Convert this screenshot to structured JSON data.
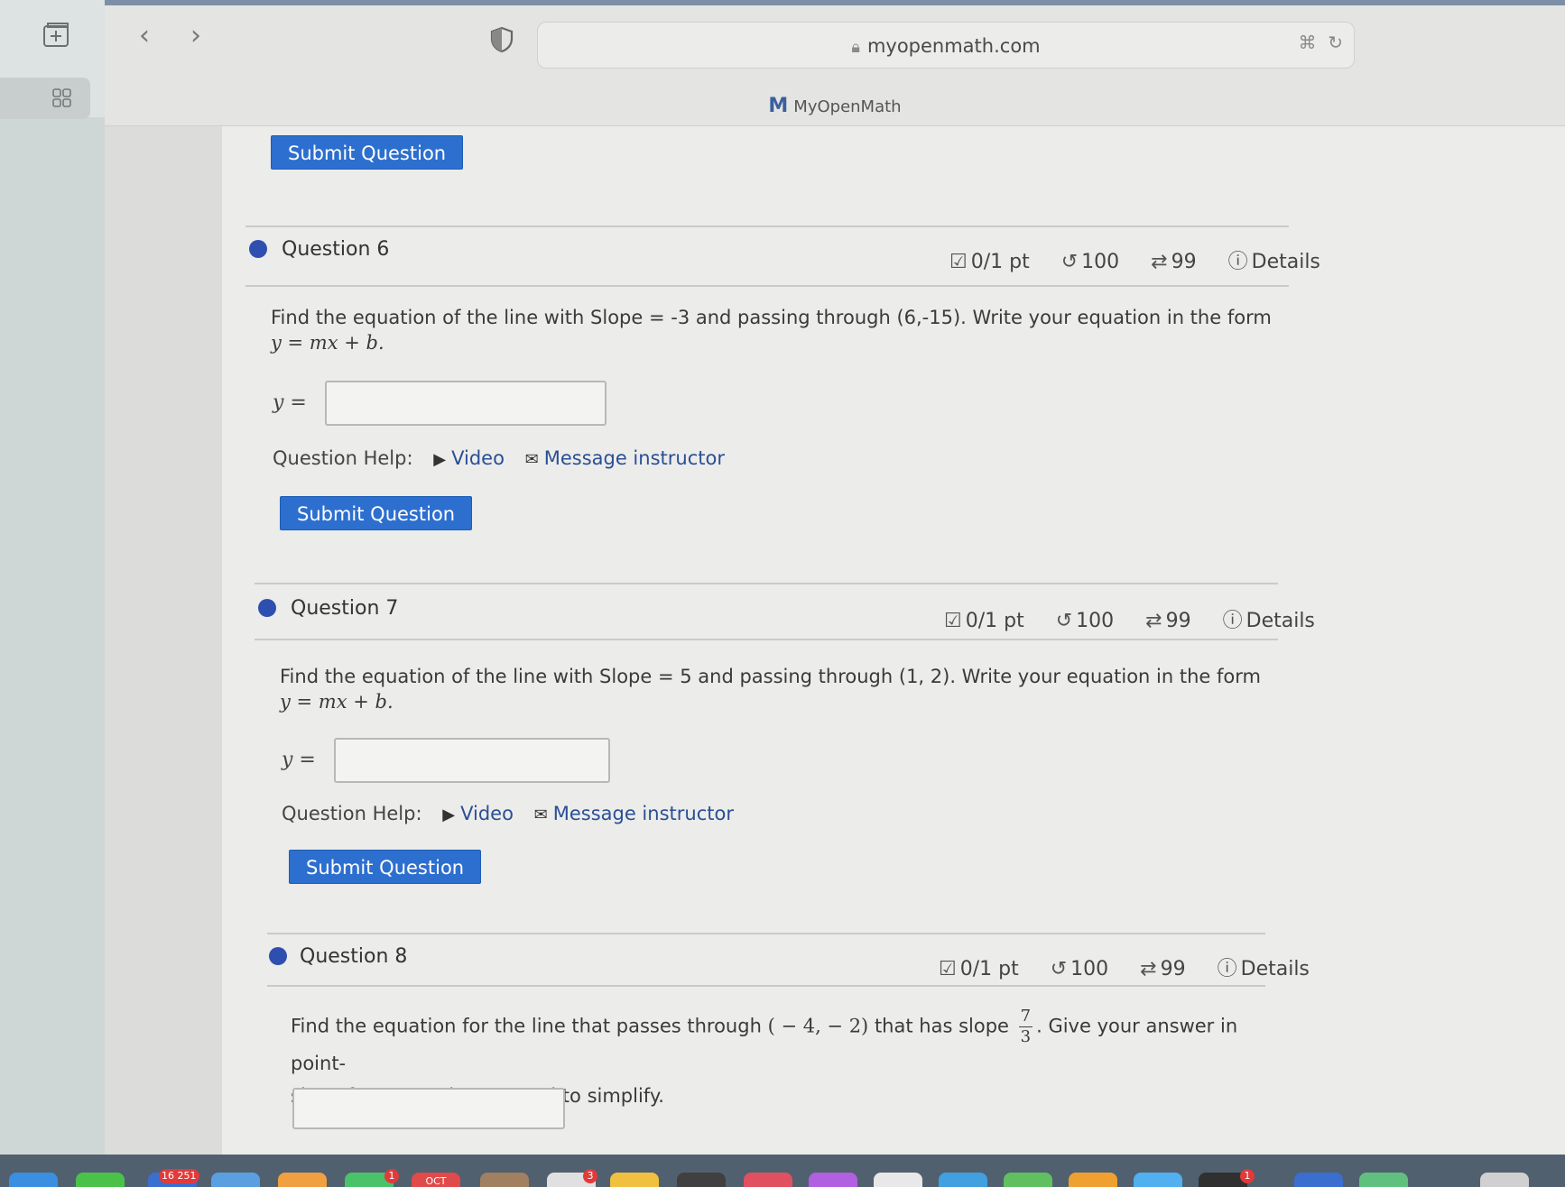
{
  "browser": {
    "url": "myopenmath.com",
    "tab_title": "MyOpenMath",
    "colors": {
      "accent": "#2d6fcf",
      "dot": "#2f4fb0",
      "link": "#2a4f95"
    }
  },
  "top_submit_label": "Submit Question",
  "questions": [
    {
      "title": "Question 6",
      "score": "0/1 pt",
      "retries": "100",
      "attempts": "99",
      "details": "Details",
      "text_a": "Find the equation of the line with Slope = -3 and passing through (6,-15). Write your equation in the form",
      "text_b": "y = mx + b.",
      "y_label": "y =",
      "help_label": "Question Help:",
      "video_label": "Video",
      "message_label": "Message instructor",
      "submit_label": "Submit Question"
    },
    {
      "title": "Question 7",
      "score": "0/1 pt",
      "retries": "100",
      "attempts": "99",
      "details": "Details",
      "text_a": "Find the equation of the line with Slope = 5 and passing through (1, 2). Write your equation in the form",
      "text_b": "y = mx + b.",
      "y_label": "y =",
      "help_label": "Question Help:",
      "video_label": "Video",
      "message_label": "Message instructor",
      "submit_label": "Submit Question"
    },
    {
      "title": "Question 8",
      "score": "0/1 pt",
      "retries": "100",
      "attempts": "99",
      "details": "Details",
      "text_a1": "Find the equation for the line that passes through",
      "point": "( − 4,  − 2)",
      "text_a2": "that has slope",
      "frac_num": "7",
      "frac_den": "3",
      "text_a3": ". Give your answer in point-",
      "text_b": "slope form. You do not need to simplify."
    }
  ],
  "dock": {
    "badge_date": "16 251",
    "badge_a": "1",
    "badge_b": "3",
    "badge_c": "1",
    "oct": "OCT"
  }
}
